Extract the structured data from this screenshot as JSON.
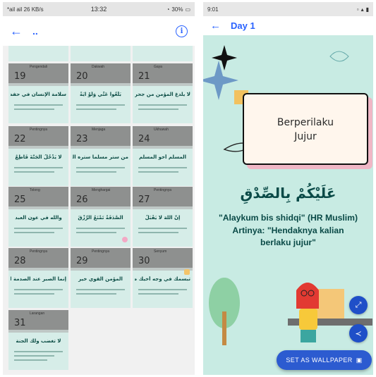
{
  "left_screen": {
    "status": {
      "left": "*ail ail 26 KB/s",
      "time": "13:32",
      "battery": "30%"
    },
    "toolbar": {
      "back_icon": "arrow-left-icon",
      "title": "..",
      "info_icon": "info-icon",
      "info_glyph": "i"
    },
    "tiles": [
      {
        "num": "19",
        "label": "Pengendali",
        "arabic": "سلامة الإنسان في حفظ اللسان"
      },
      {
        "num": "20",
        "label": "Dakwah",
        "arabic": "بَلِّغُوا عَنِّي وَلَوْ آيَةً"
      },
      {
        "num": "21",
        "label": "Gaya",
        "arabic": "لا يلدغ المؤمن من جحر"
      },
      {
        "num": "22",
        "label": "Pentingnya",
        "arabic": "لا يَدْخُلُ الْجَنَّةَ قَاطِعٌ"
      },
      {
        "num": "23",
        "label": "Menjaga",
        "arabic": "من ستر مسلما ستره الله"
      },
      {
        "num": "24",
        "label": "Ukhuwah",
        "arabic": "المسلم أخو المسلم"
      },
      {
        "num": "25",
        "label": "Tolong",
        "arabic": "والله في عون العبد"
      },
      {
        "num": "26",
        "label": "Menghargai",
        "arabic": "الصَّدَقَةُ تَمْنَعُ الرِّزْقَ"
      },
      {
        "num": "27",
        "label": "Pentingnya",
        "arabic": "إنَّ اللهَ لا يَقْبَلُ"
      },
      {
        "num": "28",
        "label": "Pentingnya",
        "arabic": "إنما الصبر عند الصدمة الأولى"
      },
      {
        "num": "29",
        "label": "Pentingnya",
        "arabic": "المؤمن القوي خير"
      },
      {
        "num": "30",
        "label": "Senyum",
        "arabic": "تبسمك في وجه أخيك صدقة"
      },
      {
        "num": "31",
        "label": "Larangan",
        "arabic": "لا تغضب ولك الجنة"
      }
    ]
  },
  "right_screen": {
    "status": {
      "time": "9:01"
    },
    "toolbar": {
      "back_icon": "arrow-left-icon",
      "title": "Day 1"
    },
    "wallpaper": {
      "card_title_line1": "Berperilaku",
      "card_title_line2": "Jujur",
      "arabic": "عَلَيْكُمْ بِالصِّدْقِ",
      "transliteration": "\"Alaykum bis shidqi\" (HR Muslim)",
      "translation_line1": "Artinya: \"Hendaknya kalian",
      "translation_line2": "berlaku jujur\""
    },
    "fab_fullscreen_icon": "fullscreen-icon",
    "fab_share_icon": "share-icon",
    "set_wallpaper_label": "SET AS WALLPAPER",
    "set_wallpaper_icon": "image-icon"
  },
  "colors": {
    "accent": "#2962ff",
    "wall_bg": "#c8ebe3",
    "text_green": "#0a4a47",
    "button_blue": "#2c5bd0"
  }
}
